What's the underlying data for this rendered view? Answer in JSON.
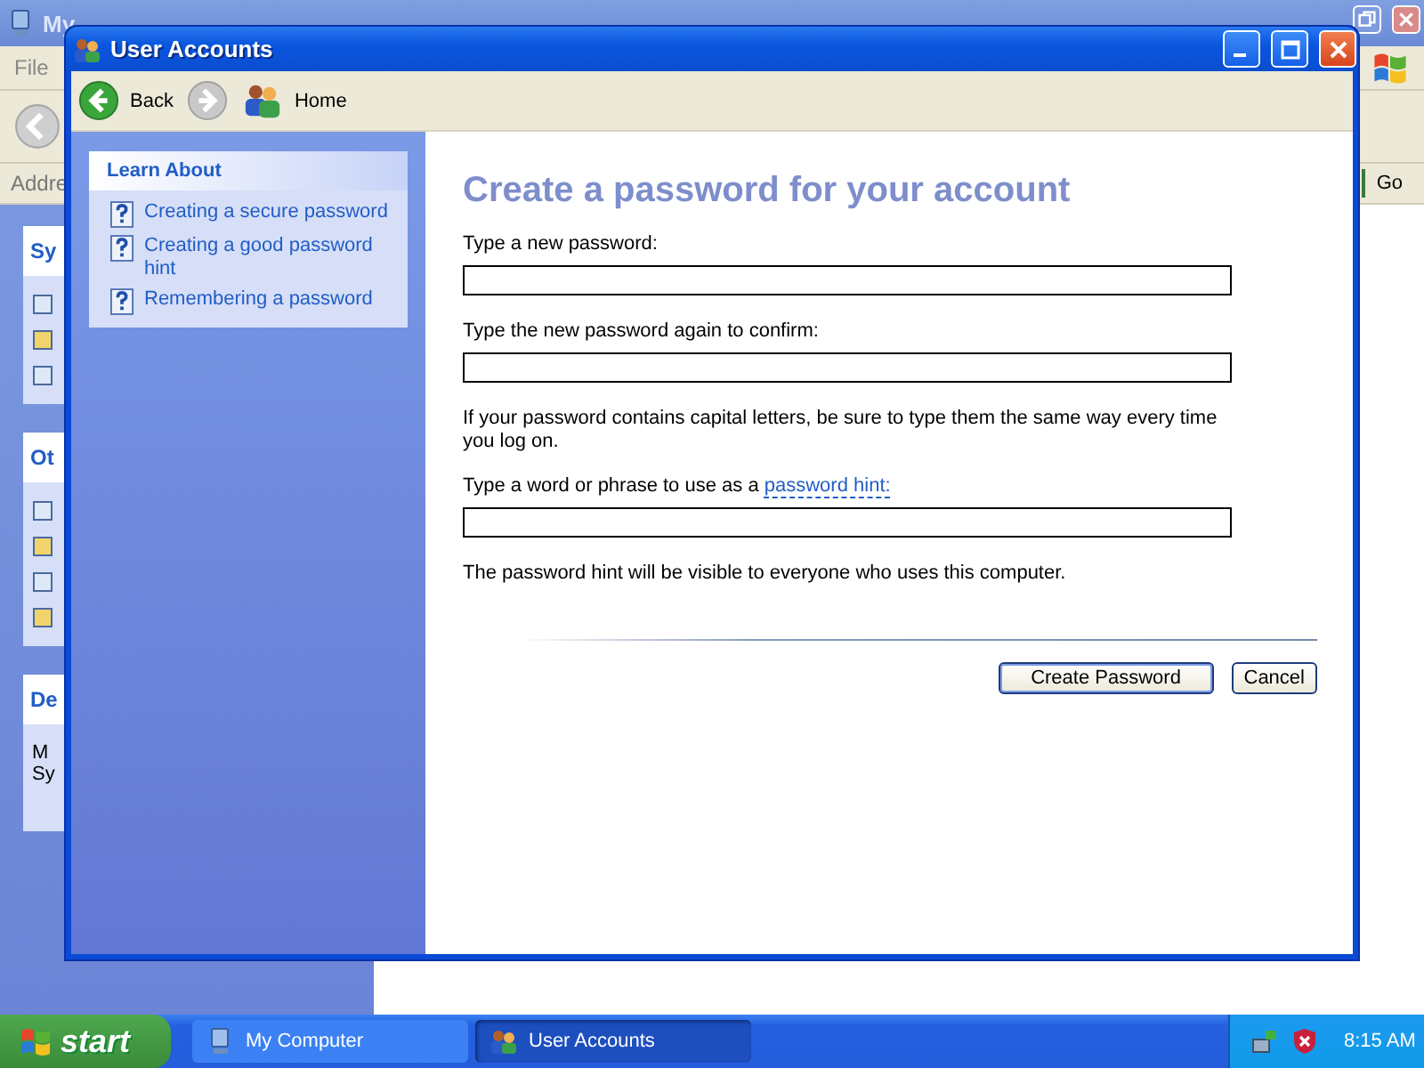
{
  "background_window": {
    "title": "My",
    "menu": [
      "File"
    ],
    "address_label": "Addre",
    "go_button": "Go",
    "task_panes": [
      {
        "title": "Sy"
      },
      {
        "title": "Ot"
      },
      {
        "title": "De",
        "lines": [
          "M",
          "Sy"
        ]
      }
    ]
  },
  "window": {
    "title": "User Accounts",
    "toolbar": {
      "back": "Back",
      "forward_disabled": true,
      "home": "Home"
    },
    "learn_about": {
      "title": "Learn About",
      "links": [
        "Creating a secure password",
        "Creating a good password hint",
        "Remembering a password"
      ]
    },
    "heading": "Create a password for your account",
    "items": [
      {
        "kind": "field",
        "label": "Type a new password:"
      },
      {
        "kind": "field",
        "label": "Type the new password again to confirm:"
      },
      {
        "kind": "note",
        "text": "If your password contains capital letters, be sure to type them the same way every time you log on."
      },
      {
        "kind": "field",
        "label": "Type a word or phrase to use as a ",
        "link": "password hint:"
      },
      {
        "kind": "note",
        "text": "The password hint will be visible to everyone who uses this computer."
      }
    ],
    "buttons": [
      {
        "label": "Create Password",
        "default": true
      },
      {
        "label": "Cancel",
        "default": false
      }
    ]
  },
  "taskbar": {
    "start": "start",
    "tasks": [
      {
        "label": "My Computer",
        "selected": false
      },
      {
        "label": "User Accounts",
        "selected": true
      }
    ],
    "clock": "8:15 AM"
  }
}
